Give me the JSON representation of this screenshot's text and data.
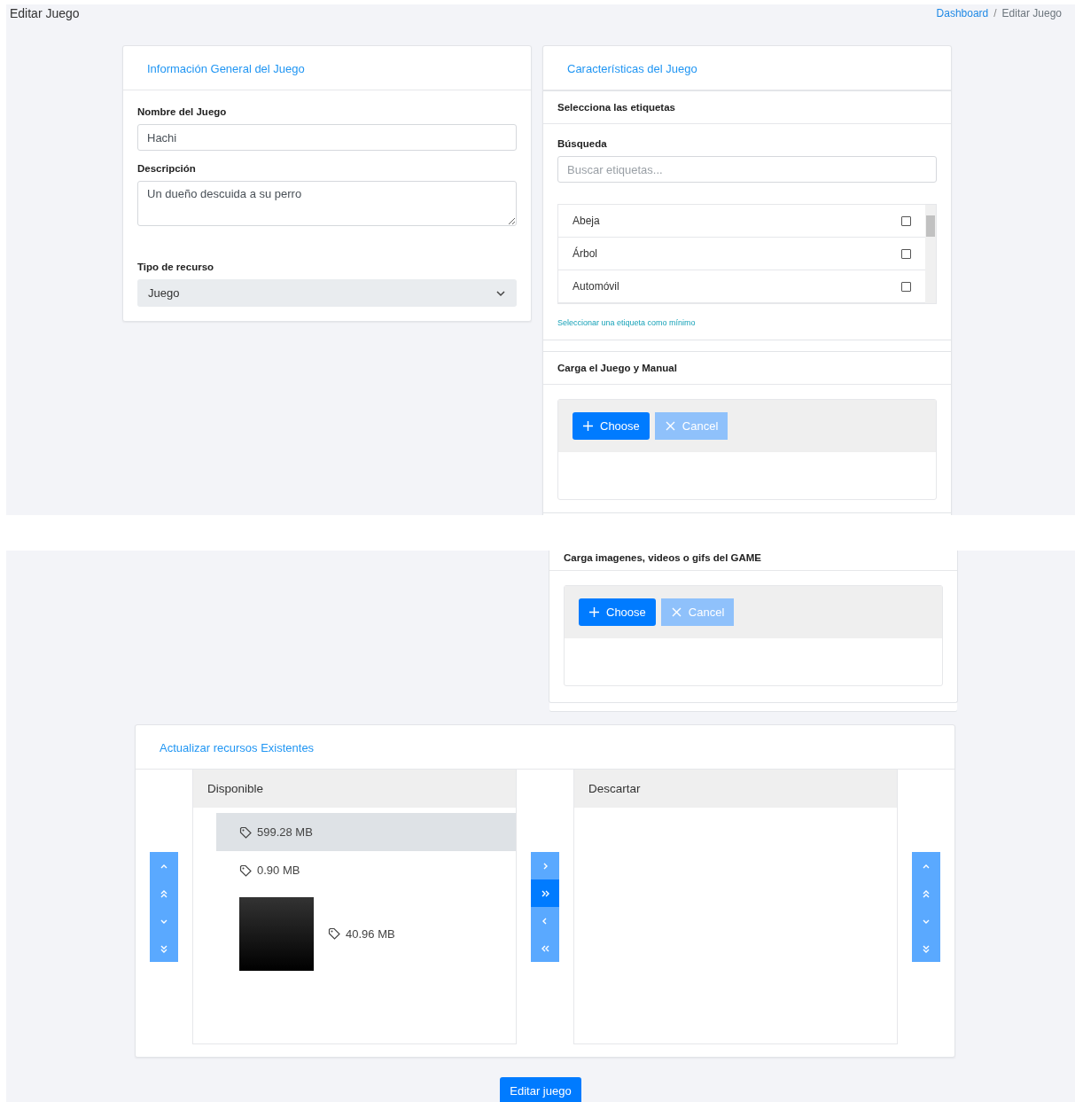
{
  "page_title": "Editar Juego",
  "breadcrumb": [
    {
      "label": "Dashboard",
      "link": true
    },
    {
      "label": "Editar Juego",
      "link": false
    }
  ],
  "breadcrumb_separator": "/",
  "general_card": {
    "title": "Información General del Juego",
    "fields": [
      {
        "kind": "input",
        "label": "Nombre del Juego",
        "value": "Hachi"
      },
      {
        "kind": "textarea",
        "label": "Descripción",
        "value": "Un dueño descuida a su perro"
      },
      {
        "kind": "select",
        "label": "Tipo de recurso",
        "value": "Juego"
      }
    ]
  },
  "features_card": {
    "title": "Características del Juego",
    "tags": {
      "title": "Selecciona las etiquetas",
      "search_label": "Búsqueda",
      "placeholder": "Buscar etiquetas...",
      "items": [
        {
          "label": "Abeja",
          "checked": false
        },
        {
          "label": "Árbol",
          "checked": false
        },
        {
          "label": "Automóvil",
          "checked": false
        }
      ],
      "hint": "Seleccionar una etiqueta como mínimo"
    },
    "uploads": [
      {
        "title": "Carga el Juego y Manual",
        "buttons": [
          {
            "kind": "choose",
            "label": "Choose",
            "disabled": false
          },
          {
            "kind": "cancel",
            "label": "Cancel",
            "disabled": true
          }
        ]
      },
      {
        "title": "Carga imagenes, videos o gifs del GAME",
        "buttons": [
          {
            "kind": "choose",
            "label": "Choose",
            "disabled": false
          },
          {
            "kind": "cancel",
            "label": "Cancel",
            "disabled": true
          }
        ]
      }
    ]
  },
  "resources_card": {
    "title": "Actualizar recursos Existentes",
    "source_controls": [
      {
        "kind": "up",
        "disabled": true
      },
      {
        "kind": "top",
        "disabled": true
      },
      {
        "kind": "down",
        "disabled": true
      },
      {
        "kind": "bottom",
        "disabled": true
      }
    ],
    "source": {
      "header": "Disponible",
      "items": [
        {
          "kind": "file",
          "label": "599.28 MB",
          "selected": true
        },
        {
          "kind": "file",
          "label": "0.90 MB",
          "selected": false
        },
        {
          "kind": "video",
          "label": "40.96 MB",
          "selected": false
        }
      ]
    },
    "transfer_controls": [
      {
        "kind": "right",
        "disabled": true
      },
      {
        "kind": "all-right",
        "disabled": false
      },
      {
        "kind": "left",
        "disabled": true
      },
      {
        "kind": "all-left",
        "disabled": true
      }
    ],
    "target": {
      "header": "Descartar"
    },
    "target_controls": [
      {
        "kind": "up",
        "disabled": true
      },
      {
        "kind": "top",
        "disabled": true
      },
      {
        "kind": "down",
        "disabled": true
      },
      {
        "kind": "bottom",
        "disabled": true
      }
    ]
  },
  "submit": {
    "label": "Editar juego"
  }
}
